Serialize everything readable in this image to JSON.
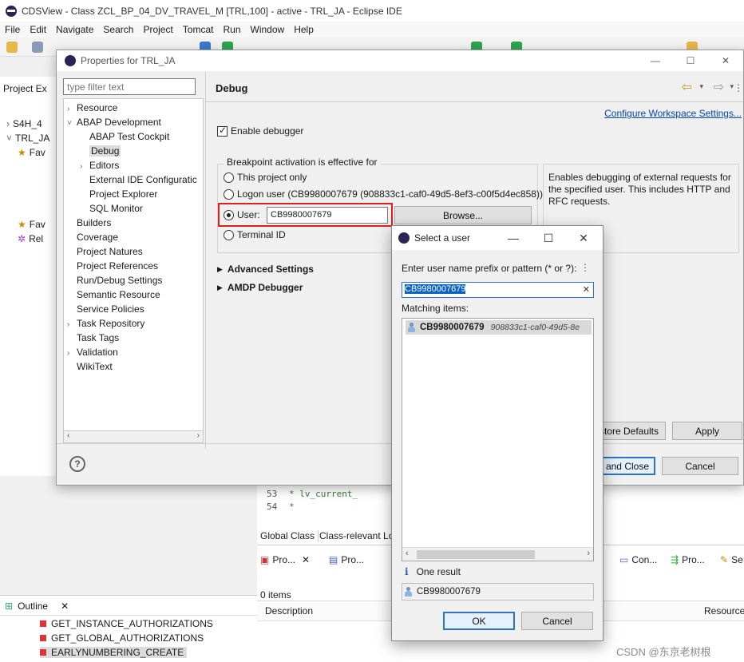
{
  "window": {
    "title": "CDSView - Class ZCL_BP_04_DV_TRAVEL_M [TRL,100] - active - TRL_JA - Eclipse IDE"
  },
  "menu": [
    "File",
    "Edit",
    "Navigate",
    "Search",
    "Project",
    "Tomcat",
    "Run",
    "Window",
    "Help"
  ],
  "background": {
    "project_explorer_tab": "Project Ex",
    "tree": [
      "S4H_4",
      "TRL_JA",
      "Fav",
      "Fav",
      "Rel"
    ],
    "outline_tab": "Outline",
    "outline_items": [
      "GET_INSTANCE_AUTHORIZATIONS",
      "GET_GLOBAL_AUTHORIZATIONS",
      "EARLYNUMBERING_CREATE"
    ],
    "editor_lines": [
      {
        "num": "53",
        "text": "*      lv_current_"
      },
      {
        "num": "54",
        "text": "*"
      }
    ],
    "editor_tabs": [
      "Global Class",
      "Class-relevant Lo"
    ],
    "view_tabs": [
      "Pro...",
      "Pro...",
      "Con...",
      "Pro...",
      "Se"
    ],
    "items_count": "0 items",
    "table_headers": [
      "Description",
      "Resource"
    ],
    "watermark": "CSDN @东京老树根"
  },
  "properties_dialog": {
    "title": "Properties for TRL_JA",
    "filter_placeholder": "type filter text",
    "tree": [
      {
        "label": "Resource",
        "level": 0,
        "expander": ">"
      },
      {
        "label": "ABAP Development",
        "level": 0,
        "expander": "v"
      },
      {
        "label": "ABAP Test Cockpit",
        "level": 1,
        "expander": ""
      },
      {
        "label": "Debug",
        "level": 1,
        "expander": "",
        "selected": true
      },
      {
        "label": "Editors",
        "level": 1,
        "expander": ">"
      },
      {
        "label": "External IDE Configuratic",
        "level": 1,
        "expander": ""
      },
      {
        "label": "Project Explorer",
        "level": 1,
        "expander": ""
      },
      {
        "label": "SQL Monitor",
        "level": 1,
        "expander": ""
      },
      {
        "label": "Builders",
        "level": 0,
        "expander": ""
      },
      {
        "label": "Coverage",
        "level": 0,
        "expander": ""
      },
      {
        "label": "Project Natures",
        "level": 0,
        "expander": ""
      },
      {
        "label": "Project References",
        "level": 0,
        "expander": ""
      },
      {
        "label": "Run/Debug Settings",
        "level": 0,
        "expander": ""
      },
      {
        "label": "Semantic Resource",
        "level": 0,
        "expander": ""
      },
      {
        "label": "Service Policies",
        "level": 0,
        "expander": ""
      },
      {
        "label": "Task Repository",
        "level": 0,
        "expander": ">"
      },
      {
        "label": "Task Tags",
        "level": 0,
        "expander": ""
      },
      {
        "label": "Validation",
        "level": 0,
        "expander": ">"
      },
      {
        "label": "WikiText",
        "level": 0,
        "expander": ""
      }
    ],
    "page_title": "Debug",
    "configure_link": "Configure Workspace Settings...",
    "enable_debugger": "Enable debugger",
    "breakpoint_group": "Breakpoint activation is effective for",
    "radio_this_project": "This project only",
    "radio_logon_user": "Logon user (CB9980007679 (908833c1-caf0-49d5-8ef3-c00f5d4ec858))",
    "radio_user": "User:",
    "user_value": "CB9980007679",
    "browse": "Browse...",
    "radio_terminal": "Terminal ID",
    "info_text": "Enables debugging of external requests for the specified user. This includes HTTP and RFC requests.",
    "advanced_settings": "Advanced Settings",
    "amdp_debugger": "AMDP Debugger",
    "restore_defaults": "Restore Defaults",
    "apply": "Apply",
    "apply_close": "Apply and Close",
    "cancel": "Cancel"
  },
  "select_user_dialog": {
    "title": "Select a user",
    "prompt": "Enter user name prefix or pattern (* or ?):",
    "input_value": "CB9980007679",
    "matching_label": "Matching items:",
    "result_name": "CB9980007679",
    "result_id": "908833c1-caf0-49d5-8e",
    "result_count": "One result",
    "selected_value": "CB9980007679",
    "ok": "OK",
    "cancel": "Cancel"
  },
  "colors": {
    "accent": "#2b74c7",
    "highlight_border": "#e02020",
    "selection": "#0a64c8"
  }
}
